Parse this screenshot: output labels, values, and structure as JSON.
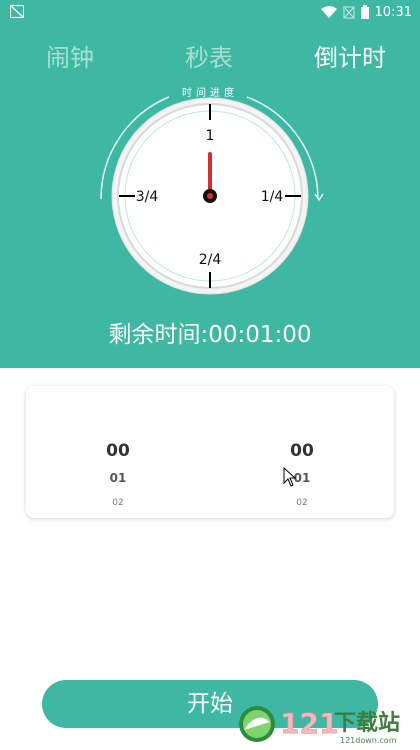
{
  "status_bar": {
    "time": "10:31",
    "icons": [
      "notification-icon",
      "wifi-icon",
      "signal-off-icon",
      "battery-icon"
    ]
  },
  "tabs": [
    {
      "label": "闹钟",
      "active": false
    },
    {
      "label": "秒表",
      "active": false
    },
    {
      "label": "倒计时",
      "active": true
    }
  ],
  "clock": {
    "arc_label": "时间进度",
    "marks": {
      "top": "1",
      "right": "1/4",
      "bottom": "2/4",
      "left": "3/4"
    },
    "progress": 0
  },
  "remaining_label": "剩余时间:00:01:00",
  "picker": {
    "left": [
      "00",
      "01",
      "02"
    ],
    "right": [
      "00",
      "01",
      "02"
    ]
  },
  "start_button": "开始",
  "watermark": {
    "brand": "121",
    "text": "下载站",
    "url": "121down.com"
  },
  "colors": {
    "primary": "#3fb8a3",
    "hand": "#d42f2f"
  }
}
